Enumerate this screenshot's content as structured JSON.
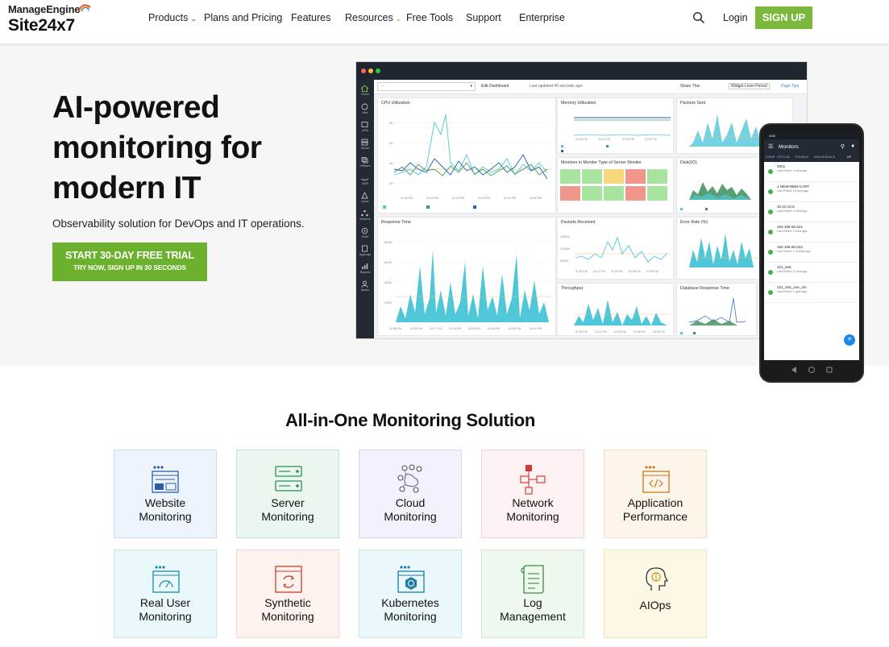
{
  "header": {
    "logo_top": "ManageEngine",
    "logo_bottom": "Site24x7",
    "nav": [
      {
        "label": "Products",
        "caret": true
      },
      {
        "label": "Plans and Pricing",
        "caret": false
      },
      {
        "label": "Features",
        "caret": false
      },
      {
        "label": "Resources",
        "caret": true
      },
      {
        "label": "Free Tools",
        "caret": false
      },
      {
        "label": "Support",
        "caret": false
      },
      {
        "label": "Enterprise",
        "caret": false
      }
    ],
    "login": "Login",
    "signup": "SIGN UP"
  },
  "hero": {
    "title": "AI-powered monitoring for modern IT",
    "subtitle": "Observability solution for DevOps and IT operations.",
    "cta_main": "START 30-DAY FREE TRIAL",
    "cta_sub": "TRY NOW, SIGN UP IN 30 SECONDS"
  },
  "dashboard": {
    "toolbar": {
      "edit": "Edit Dashboard",
      "updated": "Last updated 45 seconds ago",
      "share": "Share This",
      "widget": "Widget Level Period",
      "tips": "Page Tips"
    },
    "sidebar": [
      "Home",
      "Web",
      "APM",
      "Server",
      "VMware",
      "AWS",
      "Azure",
      "Network",
      "RUM",
      "AppLogs",
      "Reports",
      "Admin"
    ],
    "panels": {
      "cpu": "CPU Utilization",
      "memory": "Memory Utilization",
      "packets_sent": "Packets Sent",
      "monitors": "Monitors in Monitor Type of Server Monitor",
      "disk": "Disk(I/O)",
      "response": "Response Time",
      "packets_received": "Packets Received",
      "error_rate": "Error Rate (%)",
      "throughput": "Throughput",
      "db_response": "Database Response Time"
    }
  },
  "phone": {
    "status": "4:55",
    "title": "Monitors",
    "tabs": [
      "DOWN",
      "CRITICAL",
      "TROUBLE",
      "MAINTENANCE",
      "UP"
    ],
    "items": [
      {
        "name": "0001",
        "sub": "Last Polled: 4 mins ago"
      },
      {
        "name": "1 NEW-RBM-CART",
        "sub": "Last Polled: 18 secs ago"
      },
      {
        "name": "10.10.10.6",
        "sub": "Last Polled: 3 mins ago"
      },
      {
        "name": "192.168.50.221",
        "sub": "Last Polled: 3 mins ago"
      },
      {
        "name": "192.168.50.222",
        "sub": "Last Polled: 2 months ago"
      },
      {
        "name": "221_test",
        "sub": "Last Polled: 6 mins ago"
      },
      {
        "name": "221_test_one_vm",
        "sub": "Last Polled: 1 year ago"
      }
    ],
    "fab": "+"
  },
  "solutions": {
    "title": "All-in-One Monitoring Solution",
    "cards": [
      {
        "line1": "Website",
        "line2": "Monitoring",
        "icon": "website-icon"
      },
      {
        "line1": "Server",
        "line2": "Monitoring",
        "icon": "server-icon"
      },
      {
        "line1": "Cloud",
        "line2": "Monitoring",
        "icon": "cloud-icon"
      },
      {
        "line1": "Network",
        "line2": "Monitoring",
        "icon": "network-icon"
      },
      {
        "line1": "Application",
        "line2": "Performance",
        "icon": "application-icon"
      },
      {
        "line1": "Real User",
        "line2": "Monitoring",
        "icon": "gauge-icon"
      },
      {
        "line1": "Synthetic",
        "line2": "Monitoring",
        "icon": "synthetic-icon"
      },
      {
        "line1": "Kubernetes",
        "line2": "Monitoring",
        "icon": "kubernetes-icon"
      },
      {
        "line1": "Log",
        "line2": "Management",
        "icon": "log-icon"
      },
      {
        "line1": "AIOps",
        "line2": "",
        "icon": "aiops-icon"
      }
    ]
  },
  "colors": {
    "brand_green": "#7bb83c",
    "cta_green": "#6bb12e",
    "chart_teal": "#4fc7d9",
    "chart_blue": "#1f5fbf"
  }
}
